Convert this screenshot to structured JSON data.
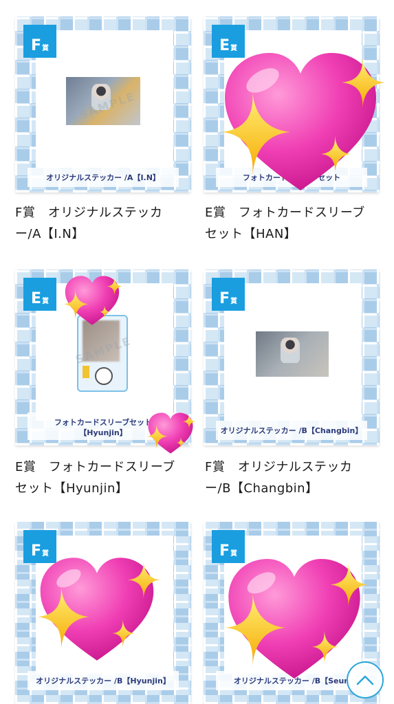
{
  "items": [
    {
      "badge_big": "F",
      "badge_small": "賞",
      "caption": "オリジナルステッカー /A【I.N】",
      "line1": "F賞　オリジナルステッカ",
      "line2": "ー/A【I.N】"
    },
    {
      "badge_big": "E",
      "badge_small": "賞",
      "caption": "フォトカードスリーブセット",
      "line1": "E賞　フォトカードスリーブ",
      "line2": "セット【HAN】"
    },
    {
      "badge_big": "E",
      "badge_small": "賞",
      "caption": "フォトカードスリーブセット",
      "caption2": "【Hyunjin】",
      "line1": "E賞　フォトカードスリーブ",
      "line2": "セット【Hyunjin】"
    },
    {
      "badge_big": "F",
      "badge_small": "賞",
      "caption": "オリジナルステッカー /B【Changbin】",
      "line1": "F賞　オリジナルステッカ",
      "line2": "ー/B【Changbin】"
    },
    {
      "badge_big": "F",
      "badge_small": "賞",
      "caption": "オリジナルステッカー /B【Hyunjin】"
    },
    {
      "badge_big": "F",
      "badge_small": "賞",
      "caption": "オリジナルステッカー /B【Seun"
    }
  ],
  "sample_watermark": "SAMPLE",
  "scroll_top_icon": "chevron-up-icon",
  "accent_color": "#1a9ee0"
}
